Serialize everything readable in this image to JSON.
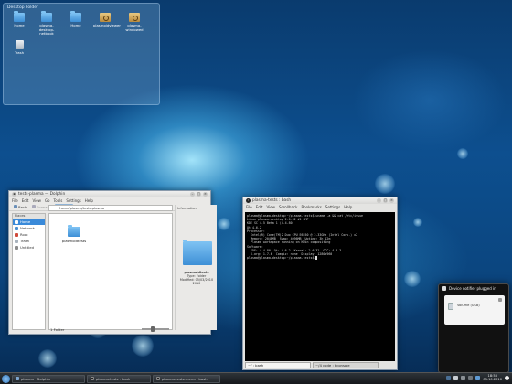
{
  "desktop": {
    "folderview_title": "Desktop Folder",
    "icons": [
      {
        "label": "Home",
        "kind": "folder-blue"
      },
      {
        "label": "plasma-desktop-netbook",
        "kind": "folder-blue"
      },
      {
        "label": "Home",
        "kind": "folder-blue"
      },
      {
        "label": "plasmoidviewer",
        "kind": "folder-tan"
      },
      {
        "label": "plasma-windowed",
        "kind": "folder-tan"
      },
      {
        "label": "Trash",
        "kind": "trash"
      }
    ]
  },
  "dolphin": {
    "title": "tests-plasma — Dolphin",
    "menu": [
      "File",
      "Edit",
      "View",
      "Go",
      "Tools",
      "Settings",
      "Help"
    ],
    "toolbar": [
      "Back",
      "Forward",
      "Icons",
      "Details",
      "Columns",
      "Preview",
      "Split"
    ],
    "places_header": "Places",
    "places": [
      "Home",
      "Network",
      "Root",
      "Trash",
      "Untitled"
    ],
    "location": "/home/plasma/tests-plasma",
    "folder_item": "plasmoidtests",
    "info_header": "Information",
    "info_name": "plasmoidtests",
    "info_lines": [
      "Type: Folder",
      "Modified: 05/03/2010",
      "2010"
    ],
    "status": "1 Folder",
    "zoom_icon": "zoom-slider-icon"
  },
  "terminal": {
    "title": "plasma-tests : bash",
    "menu": [
      "File",
      "Edit",
      "View",
      "Scrollback",
      "Bookmarks",
      "Settings",
      "Help"
    ],
    "lines": [
      "plasma@plasma-desktop:~/plasma-tests$ uname -a && cat /etc/issue",
      "Linux plasma-desktop 2.6.32 #1 SMP",
      "",
      "KDE SC 4.5 Beta 1 (4.4.80)",
      "Qt 4.6.2",
      "",
      "Processor:",
      "  Intel(R) Core(TM)2 Duo CPU E6550 @ 2.33GHz (Intel Corp.) x2",
      "  Memory: 2048MB  Swap: 4096MB  Uptime: 3h 12m",
      "  Plasma workspace running on KWin compositing",
      "",
      "Software:",
      "  KDE: 4.4.80  Qt: 4.6.2  Kernel: 2.6.32  GCC: 4.4.3",
      "  X.org: 1.7.6  Compiz: none  Display: 1280x960",
      "",
      "plasma@plasma-desktop:~/plasma-tests$ "
    ],
    "tabs": [
      "~/ : bash",
      "~/4 code : kconsole"
    ]
  },
  "notification": {
    "header": "Device notifier plugged in",
    "device_label": "Volume (USB)",
    "eject_icon": "eject-icon"
  },
  "taskbar": {
    "launcher_icon": "kde-kickoff-icon",
    "tasks": [
      {
        "label": "plasma · Dolphin"
      },
      {
        "label": "plasma-tests : bash"
      },
      {
        "label": "plasma-tests-menu - bash"
      }
    ],
    "clock_time": "18:53",
    "clock_date": "05.10.2010"
  }
}
